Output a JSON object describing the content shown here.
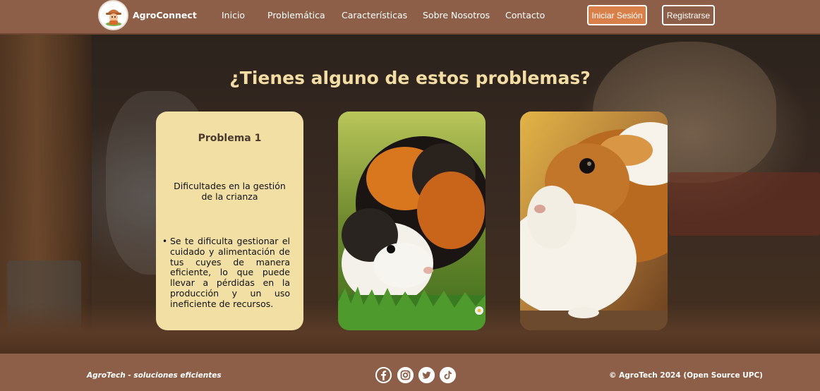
{
  "navbar": {
    "brand": "AgroConnect",
    "links": [
      "Inicio",
      "Problemática",
      "Características",
      "Sobre Nosotros",
      "Contacto"
    ],
    "login_label": "Iniciar Sesión",
    "register_label": "Registrarse"
  },
  "hero": {
    "title": "¿Tienes alguno de estos problemas?"
  },
  "problem_card": {
    "title": "Problema 1",
    "subtitle": "Dificultades en la gestión de la crianza",
    "bullets": [
      "Se te dificulta gestionar el cuidado y alimentación de tus cuyes de manera eficiente, lo que puede llevar a pérdidas en la producción y un uso ineficiente de recursos."
    ]
  },
  "footer": {
    "slogan": "AgroTech - soluciones eficientes",
    "social_icons": [
      "facebook-icon",
      "instagram-icon",
      "twitter-icon",
      "tiktok-icon"
    ],
    "copyright": "© AgroTech 2024 (Open Source UPC)"
  },
  "colors": {
    "navbar_bg": "#8e5f48",
    "accent_button": "#d9804a",
    "hero_title": "#f4dda3",
    "card_bg": "#f1dfa3"
  }
}
